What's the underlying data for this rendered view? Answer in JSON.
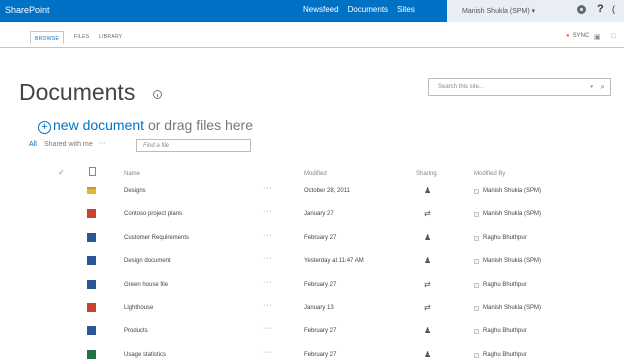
{
  "suite_bar": {
    "brand": "SharePoint",
    "links": [
      "Newsfeed",
      "Documents",
      "Sites"
    ],
    "user": "Manish Shukla (SPM) ▾",
    "help": "?",
    "extra": "("
  },
  "ribbon": {
    "tabs": [
      "BROWSE",
      "FILES",
      "LIBRARY"
    ],
    "active_tab": "BROWSE",
    "sync_label": "SYNC",
    "icons": [
      "sync-dot-icon",
      "focus-icon",
      "fullscreen-icon"
    ]
  },
  "page": {
    "title": "Documents",
    "search_placeholder": "Search this site...",
    "search_dropdown": "▾",
    "search_icon_glyph": "⌕"
  },
  "newdoc": {
    "plus": "+",
    "link": "new document",
    "rest": " or drag files here"
  },
  "views": {
    "all": "All",
    "shared": "Shared with me",
    "more": "···",
    "find_placeholder": "Find a file"
  },
  "table": {
    "columns": {
      "name": "Name",
      "modified": "Modified",
      "sharing": "Sharing",
      "modified_by": "Modified By"
    },
    "check_glyph": "✓",
    "dots_glyph": "···",
    "rows": [
      {
        "type": "folder",
        "name": "Designs",
        "modified": "October 28, 2011",
        "sharing": "people",
        "modified_by": "Manish Shukla (SPM)"
      },
      {
        "type": "ppt",
        "name": "Contoso project plans",
        "modified": "January 27",
        "sharing": "shared",
        "modified_by": "Manish Shukla (SPM)"
      },
      {
        "type": "word",
        "name": "Customer Requirements",
        "modified": "February 27",
        "sharing": "people",
        "modified_by": "Raghu Bhuthpur"
      },
      {
        "type": "word",
        "name": "Design document",
        "modified": "Yesterday at 11:47 AM",
        "sharing": "people",
        "modified_by": "Manish Shukla (SPM)"
      },
      {
        "type": "word",
        "name": "Green house file",
        "modified": "February 27",
        "sharing": "shared",
        "modified_by": "Raghu Bhuthpur"
      },
      {
        "type": "ppt",
        "name": "Lighthouse",
        "modified": "January 13",
        "sharing": "shared",
        "modified_by": "Manish Shukla (SPM)"
      },
      {
        "type": "word",
        "name": "Products",
        "modified": "February 27",
        "sharing": "people",
        "modified_by": "Raghu Bhuthpur"
      },
      {
        "type": "excel",
        "name": "Usage statistics",
        "modified": "February 27",
        "sharing": "people",
        "modified_by": "Raghu Bhuthpur"
      }
    ]
  },
  "colors": {
    "suite_bar": "#0072c6",
    "link": "#0072c6",
    "folder": "#e6b43c",
    "ppt": "#c9432d",
    "word": "#2b5797",
    "excel": "#207245"
  }
}
